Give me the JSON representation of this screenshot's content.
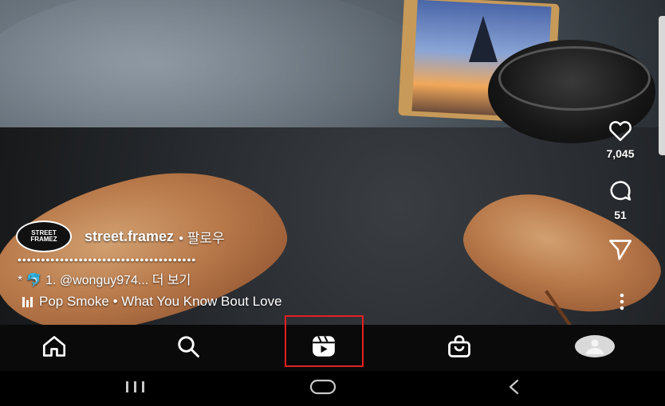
{
  "post": {
    "username": "street.framez",
    "follow_label": "• 팔로우",
    "avatar_text": "STREET FRAMEZ",
    "dots": "••••••••••••••••••••••••••••••••••••••",
    "caption": "* 🐬 1. @wonguy974... 더 보기",
    "music": "Pop Smoke • What You Know Bout Love"
  },
  "actions": {
    "likes": "7,045",
    "comments": "51"
  },
  "nav": {
    "tabs": [
      {
        "name": "home",
        "icon": "home-icon"
      },
      {
        "name": "search",
        "icon": "search-icon"
      },
      {
        "name": "reels",
        "icon": "reels-icon",
        "highlighted": true
      },
      {
        "name": "shop",
        "icon": "shop-icon"
      },
      {
        "name": "profile",
        "icon": "profile-avatar"
      }
    ]
  },
  "colors": {
    "highlight": "#e32020",
    "tabbar_bg": "#0a0a0a",
    "text": "#ffffff"
  }
}
